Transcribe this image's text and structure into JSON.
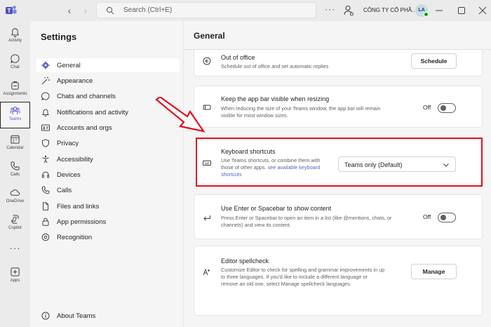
{
  "titlebar": {
    "search_placeholder": "Search (Ctrl+E)",
    "more": "···",
    "org_name": "CÔNG TY CỔ PHẦ...",
    "avatar_initials": "LA"
  },
  "appbar": {
    "items": [
      {
        "label": "Activity"
      },
      {
        "label": "Chat"
      },
      {
        "label": "Assignments"
      },
      {
        "label": "Teams"
      },
      {
        "label": "Calendar"
      },
      {
        "label": "Calls"
      },
      {
        "label": "OneDrive"
      },
      {
        "label": "Copilot"
      },
      {
        "label": "Apps"
      }
    ],
    "more": "···",
    "active_index": 3
  },
  "settings": {
    "title": "Settings",
    "items": [
      {
        "label": "General",
        "icon": "gear-icon"
      },
      {
        "label": "Appearance",
        "icon": "wand-icon"
      },
      {
        "label": "Chats and channels",
        "icon": "chat-icon"
      },
      {
        "label": "Notifications and activity",
        "icon": "bell-icon"
      },
      {
        "label": "Accounts and orgs",
        "icon": "id-card-icon"
      },
      {
        "label": "Privacy",
        "icon": "shield-icon"
      },
      {
        "label": "Accessibility",
        "icon": "accessibility-icon"
      },
      {
        "label": "Devices",
        "icon": "headset-icon"
      },
      {
        "label": "Calls",
        "icon": "phone-icon"
      },
      {
        "label": "Files and links",
        "icon": "document-icon"
      },
      {
        "label": "App permissions",
        "icon": "lock-icon"
      },
      {
        "label": "Recognition",
        "icon": "recognition-icon"
      }
    ],
    "about": "About Teams"
  },
  "main": {
    "title": "General",
    "out_of_office": {
      "title": "Out of office",
      "desc": "Schedule out of office and set automatic replies",
      "button": "Schedule"
    },
    "app_bar": {
      "title": "Keep the app bar visible when resizing",
      "desc1": "When reducing the size of your Teams window, the app bar will remain",
      "desc2": "visible for most window sizes.",
      "toggle_label": "Off"
    },
    "keyboard": {
      "title": "Keyboard shortcuts",
      "desc1": "Use Teams shortcuts, or combine them with",
      "desc2_pre": "those of other apps.",
      "desc2_link": "see available keyboard",
      "desc3_link": "shortcuts",
      "dropdown_value": "Teams only (Default)"
    },
    "enter_key": {
      "title": "Use Enter or Spacebar to show content",
      "desc1": "Press Enter or Spacebar to open an item in a list (like @mentions, chats, or",
      "desc2": "channels) and view its content.",
      "toggle_label": "Off"
    },
    "spellcheck": {
      "title": "Editor spellcheck",
      "desc1": "Customize Editor to check for spelling and grammar improvements in up",
      "desc2": "to three languages. If you'd like to include a different language or",
      "desc3": "remove an old one, select Manage spellcheck languages.",
      "button": "Manage"
    }
  },
  "colors": {
    "accent": "#5b5fc7",
    "highlight": "#e3101d"
  }
}
